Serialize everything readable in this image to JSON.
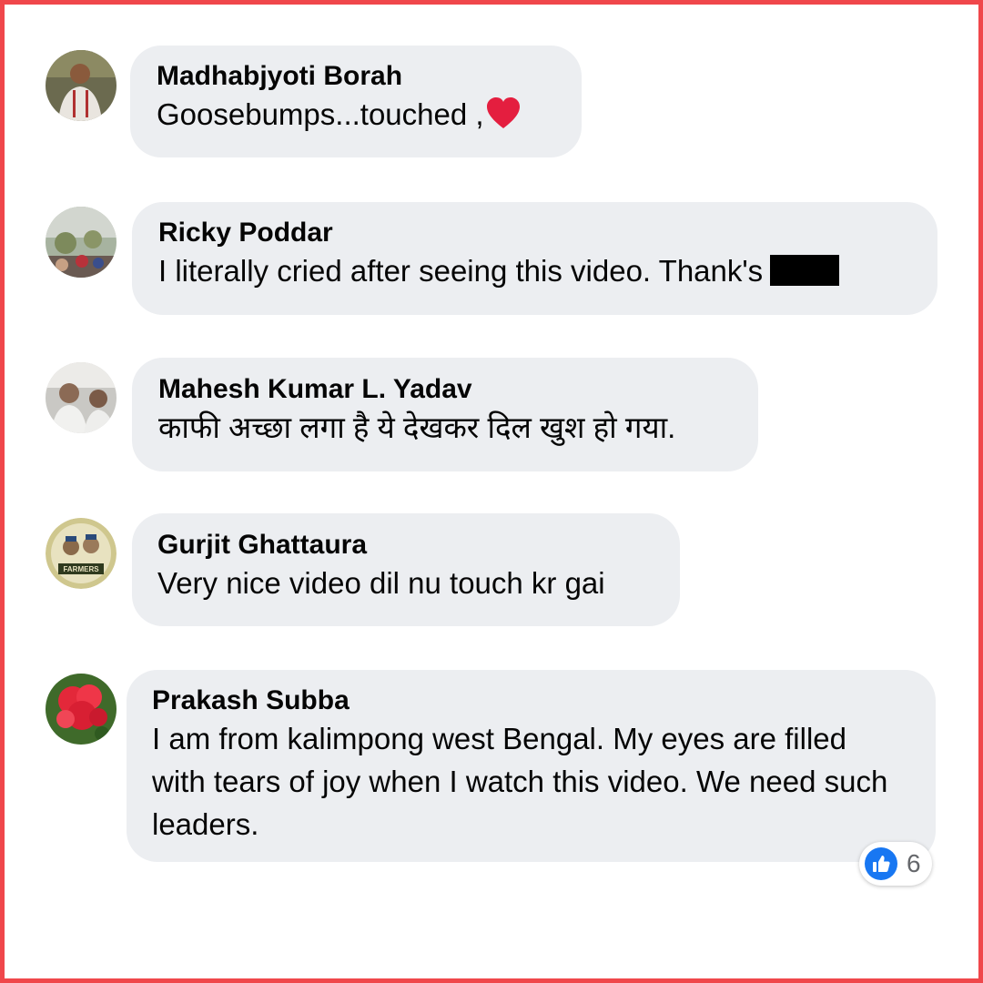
{
  "comments": [
    {
      "author": "Madhabjyoti Borah",
      "text": "Goosebumps...touched ,",
      "emoji": "heart-emoji"
    },
    {
      "author": "Ricky Poddar",
      "text": "I literally cried after seeing this video. Thank's",
      "redacted": true
    },
    {
      "author": "Mahesh Kumar L. Yadav",
      "text": "काफी अच्छा लगा है ये देखकर दिल खुश हो गया."
    },
    {
      "author": "Gurjit Ghattaura",
      "text": "Very nice video dil nu touch kr gai",
      "avatar_text": "FARMERS"
    },
    {
      "author": "Prakash Subba",
      "text": "I am from kalimpong west Bengal. My eyes are filled with tears of joy when I watch this video. We need such leaders."
    }
  ],
  "reaction": {
    "icon": "like-icon",
    "count": "6"
  },
  "colors": {
    "frame": "#f0474b",
    "bubble": "#eceef1",
    "like": "#1877f2",
    "heart": "#e41e3f"
  }
}
